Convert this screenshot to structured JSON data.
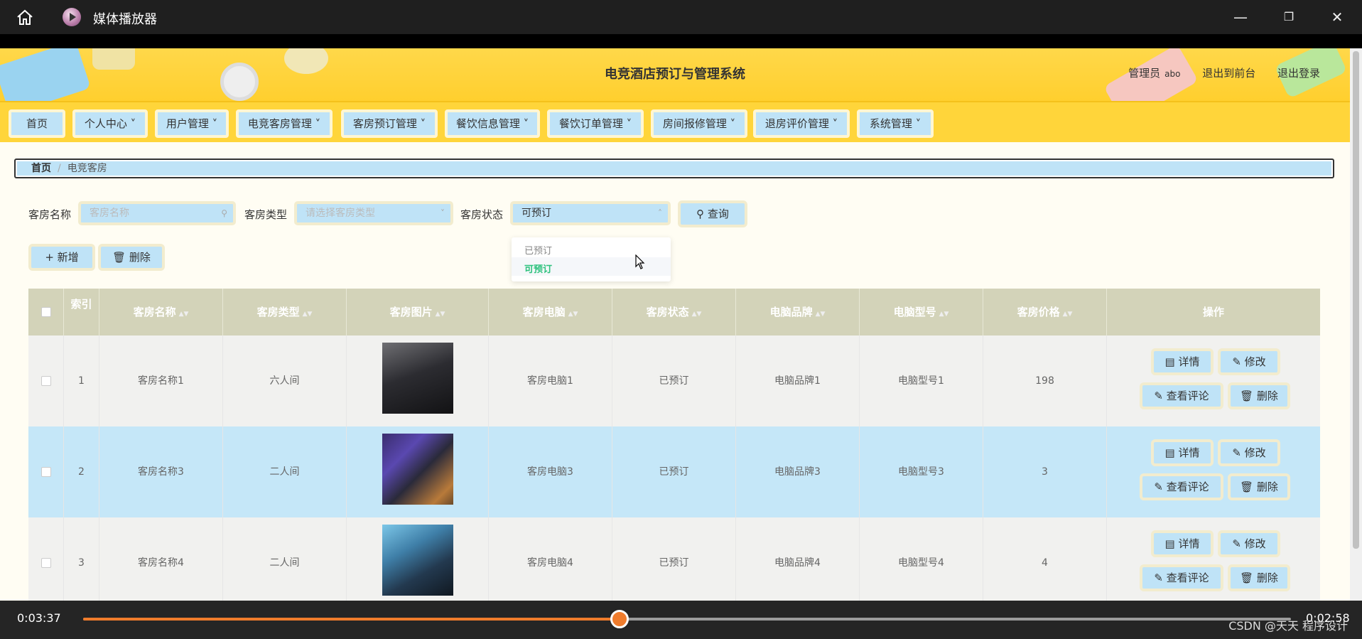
{
  "player": {
    "title": "媒体播放器",
    "elapsed": "0:03:37",
    "remaining": "0:02:58",
    "progress_fraction": 0.444,
    "accent": "#f07c2c",
    "watermark": "CSDN @天天 程序设计"
  },
  "site": {
    "title": "电竞酒店预订与管理系统",
    "role": "管理员",
    "username": "abo",
    "to_front": "退出到前台",
    "logout": "退出登录"
  },
  "nav": [
    "首页",
    "个人中心",
    "用户管理",
    "电竞客房管理",
    "客房预订管理",
    "餐饮信息管理",
    "餐饮订单管理",
    "房间报修管理",
    "退房评价管理",
    "系统管理"
  ],
  "breadcrumb": {
    "home": "首页",
    "current": "电竞客房"
  },
  "search": {
    "name_label": "客房名称",
    "name_placeholder": "客房名称",
    "type_label": "客房类型",
    "type_placeholder": "请选择客房类型",
    "status_label": "客房状态",
    "status_value": "可预订",
    "query": "查询",
    "status_options": [
      "已预订",
      "可预订"
    ]
  },
  "actions": {
    "add": "新增",
    "delete": "删除"
  },
  "table": {
    "headers": [
      "索引",
      "客房名称",
      "客房类型",
      "客房图片",
      "客房电脑",
      "客房状态",
      "电脑品牌",
      "电脑型号",
      "客房价格",
      "操作"
    ],
    "rows": [
      {
        "index": "1",
        "name": "客房名称1",
        "type": "六人间",
        "pc": "客房电脑1",
        "status": "已预订",
        "brand": "电脑品牌1",
        "model": "电脑型号1",
        "price": "198"
      },
      {
        "index": "2",
        "name": "客房名称3",
        "type": "二人间",
        "pc": "客房电脑3",
        "status": "已预订",
        "brand": "电脑品牌3",
        "model": "电脑型号3",
        "price": "3"
      },
      {
        "index": "3",
        "name": "客房名称4",
        "type": "二人间",
        "pc": "客房电脑4",
        "status": "已预订",
        "brand": "电脑品牌4",
        "model": "电脑型号4",
        "price": "4"
      }
    ],
    "ops": {
      "detail": "详情",
      "edit": "修改",
      "reviews": "查看评论",
      "delete": "删除"
    }
  }
}
